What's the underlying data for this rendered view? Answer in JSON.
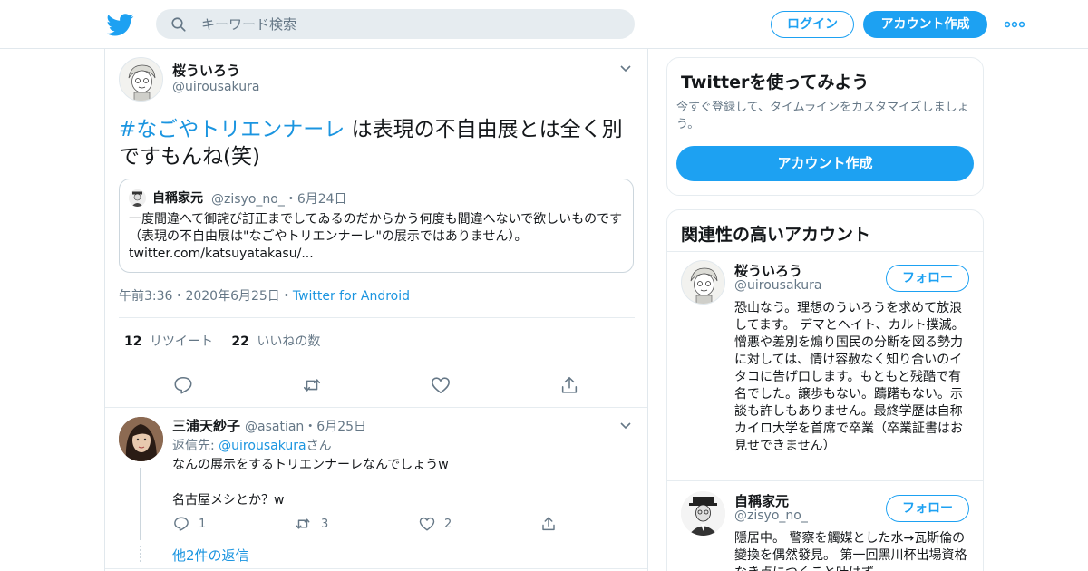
{
  "header": {
    "search_placeholder": "キーワード検索",
    "login_label": "ログイン",
    "signup_label": "アカウント作成",
    "brand_color": "#1da1f2"
  },
  "tweet": {
    "author_name": "桜ういろう",
    "author_handle": "@uirousakura",
    "hashtag": "#なごやトリエンナーレ",
    "text": " は表現の不自由展とは全く別ですもんね(笑)",
    "quote": {
      "name": "自稱家元",
      "handle": "@zisyo_no_",
      "date": "・6月24日",
      "text": "一度間違へて御詫び訂正までしてゐるのだからかう何度も間違へないで欲しいものです（表現の不自由展は\"なごやトリエンナーレ\"の展示ではありません）。twitter.com/katsuyatakasu/..."
    },
    "time": "午前3:36",
    "date": "・2020年6月25日",
    "dot": "・",
    "source": "Twitter for Android",
    "retweets_count": "12",
    "retweets_label": "リツイート",
    "likes_count": "22",
    "likes_label": "いいねの数"
  },
  "reply": {
    "name": "三浦天紗子",
    "handle": "@asatian",
    "date": "・6月25日",
    "reply_to_prefix": "返信先: ",
    "reply_to_handle": "@uirousakura",
    "reply_to_suffix": "さん",
    "line1": "なんの展示をするトリエンナーレなんでしょうw",
    "line2": "名古屋メシとか？w",
    "reply_count": "1",
    "retweet_count": "3",
    "like_count": "2",
    "more_replies": "他2件の返信"
  },
  "sidebar": {
    "try_title": "Twitterを使ってみよう",
    "try_sub": "今すぐ登録して、タイムラインをカスタマイズしましょう。",
    "signup_label": "アカウント作成",
    "related_title": "関連性の高いアカウント",
    "accounts": [
      {
        "name": "桜ういろう",
        "handle": "@uirousakura",
        "follow_label": "フォロー",
        "bio": "恐山なう。理想のういろうを求めて放浪してます。 デマとヘイト、カルト撲滅。憎悪や差別を煽り国民の分断を図る勢力に対しては、情け容赦なく知り合いのイタコに告げ口します。もともと残酷で有名でした。譲歩もない。躊躇もない。示談も許しもありません。最終学歴は自称カイロ大学を首席で卒業（卒業証書はお見せできません）"
      },
      {
        "name": "自稱家元",
        "handle": "@zisyo_no_",
        "follow_label": "フォロー",
        "bio": "隱居中。 警察を觸媒とした水→瓦斯倫の變換を偶然發見。 第一回黑川杯出場資格なき点につくこと叶はず"
      }
    ]
  }
}
